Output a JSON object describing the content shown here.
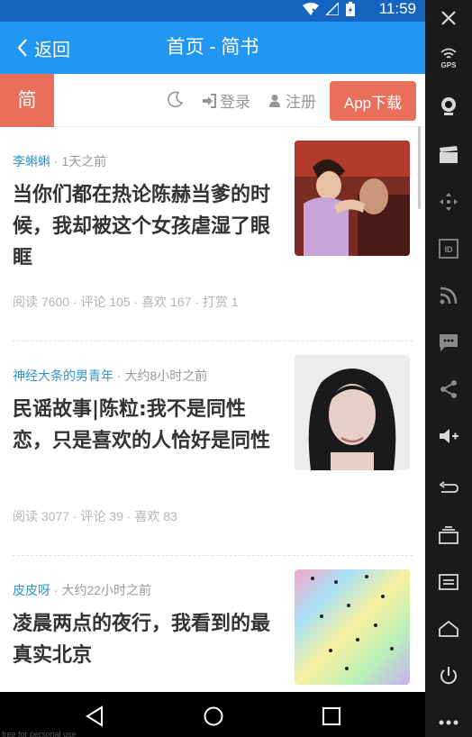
{
  "status_bar": {
    "time": "11:59"
  },
  "app_bar": {
    "back_label": "返回",
    "title": "首页 - 简书"
  },
  "toolbar": {
    "logo": "简",
    "login": "登录",
    "register": "注册",
    "download": "App下载"
  },
  "articles": [
    {
      "author": "李蝌蝌",
      "time": "1天之前",
      "title": "当你们都在热论陈赫当爹的时候，我却被这个女孩虐湿了眼眶",
      "stats": "阅读 7600 · 评论 105 · 喜欢 167 · 打赏 1"
    },
    {
      "author": "神经大条的男青年",
      "time": "大约8小时之前",
      "title": "民谣故事|陈粒:我不是同性恋，只是喜欢的人恰好是同性",
      "stats": "阅读 3077 · 评论 39 · 喜欢 83"
    },
    {
      "author": "皮皮呀",
      "time": "大约22小时之前",
      "title": "凌晨两点的夜行，我看到的最真实北京",
      "stats": ""
    }
  ],
  "side_panel": {
    "gps_label": "GPS",
    "id_label": "ID"
  },
  "watermark": "free for personal use",
  "colors": {
    "status_bar": "#1565c0",
    "app_bar": "#2196f3",
    "brand": "#ea6f5a",
    "author": "#3194d0"
  }
}
